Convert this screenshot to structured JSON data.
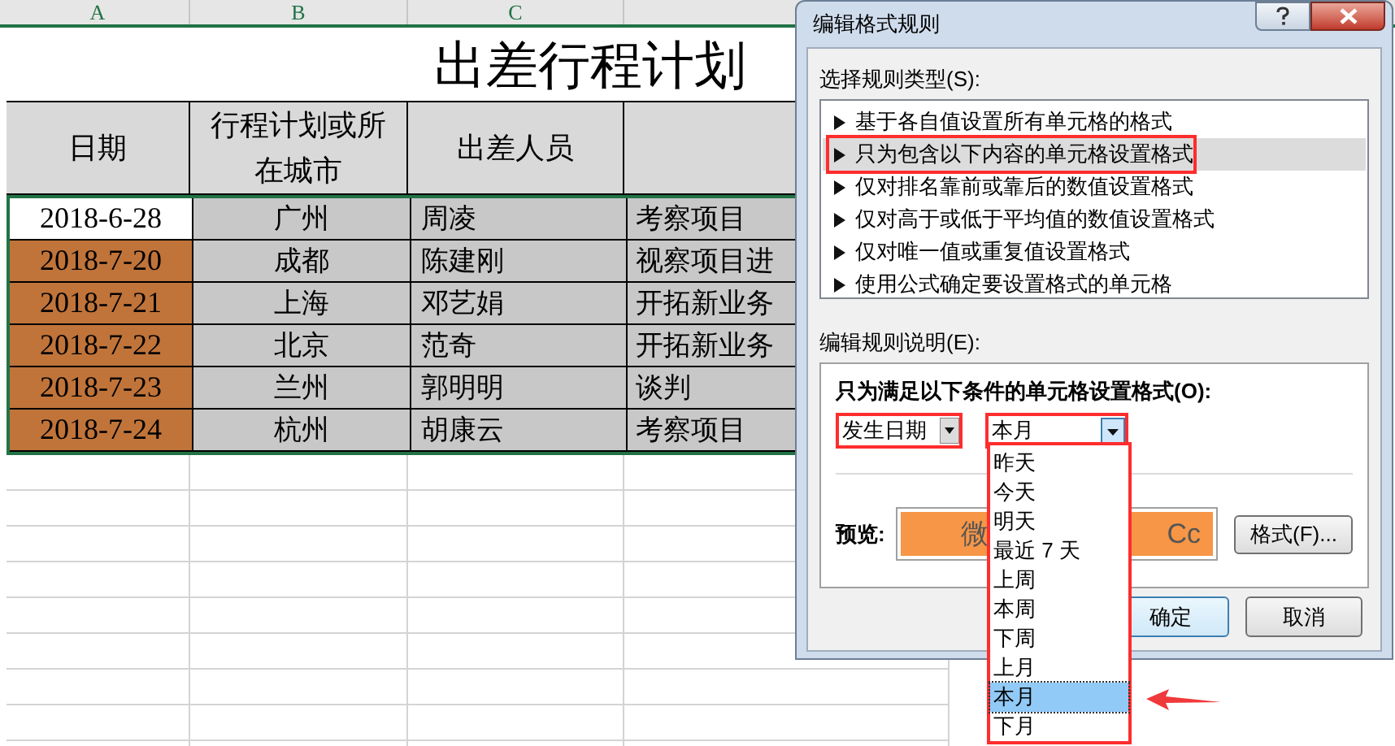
{
  "sheet": {
    "column_headers": [
      "A",
      "B",
      "C"
    ],
    "title": "出差行程计划",
    "headers": [
      "日期",
      "行程计划或所在城市",
      "出差人员"
    ],
    "rows": [
      {
        "date": "2018-6-28",
        "city": "广州",
        "person": "周凌",
        "task": "考察项目",
        "highlighted": false
      },
      {
        "date": "2018-7-20",
        "city": "成都",
        "person": "陈建刚",
        "task": "视察项目进",
        "highlighted": true
      },
      {
        "date": "2018-7-21",
        "city": "上海",
        "person": "邓艺娟",
        "task": "开拓新业务",
        "highlighted": true
      },
      {
        "date": "2018-7-22",
        "city": "北京",
        "person": "范奇",
        "task": "开拓新业务",
        "highlighted": true
      },
      {
        "date": "2018-7-23",
        "city": "兰州",
        "person": "郭明明",
        "task": "谈判",
        "highlighted": true
      },
      {
        "date": "2018-7-24",
        "city": "杭州",
        "person": "胡康云",
        "task": "考察项目",
        "highlighted": true
      }
    ]
  },
  "dialog": {
    "title": "编辑格式规则",
    "rule_type_label": "选择规则类型(S):",
    "rule_types": [
      {
        "label": "基于各自值设置所有单元格的格式",
        "selected": false
      },
      {
        "label": "只为包含以下内容的单元格设置格式",
        "selected": true
      },
      {
        "label": "仅对排名靠前或靠后的数值设置格式",
        "selected": false
      },
      {
        "label": "仅对高于或低于平均值的数值设置格式",
        "selected": false
      },
      {
        "label": "仅对唯一值或重复值设置格式",
        "selected": false
      },
      {
        "label": "使用公式确定要设置格式的单元格",
        "selected": false
      }
    ],
    "description_label": "编辑规则说明(E):",
    "condition_label": "只为满足以下条件的单元格设置格式(O):",
    "condition_type": "发生日期",
    "period": "本月",
    "period_options": [
      {
        "label": "昨天",
        "selected": false
      },
      {
        "label": "今天",
        "selected": false
      },
      {
        "label": "明天",
        "selected": false
      },
      {
        "label": "最近 7 天",
        "selected": false
      },
      {
        "label": "上周",
        "selected": false
      },
      {
        "label": "本周",
        "selected": false
      },
      {
        "label": "下周",
        "selected": false
      },
      {
        "label": "上月",
        "selected": false
      },
      {
        "label": "本月",
        "selected": true
      },
      {
        "label": "下月",
        "selected": false
      }
    ],
    "preview_label": "预览:",
    "preview_text_left": "微",
    "preview_text_right": "Cc",
    "format_button": "格式(F)...",
    "ok_button": "确定",
    "cancel_button": "取消"
  }
}
